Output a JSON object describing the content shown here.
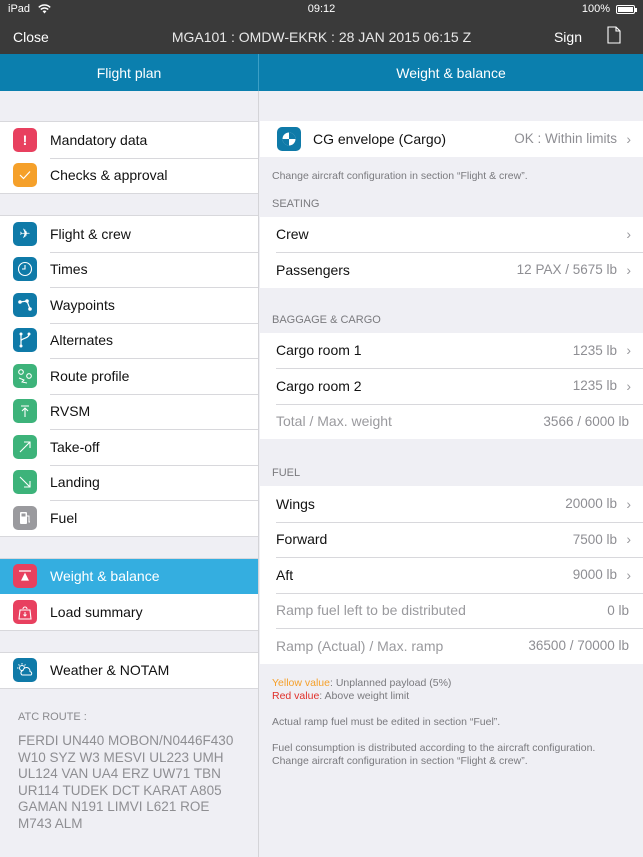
{
  "status_bar": {
    "device": "iPad",
    "time": "09:12",
    "battery": "100%",
    "battery_level": 1.0
  },
  "nav_bar": {
    "close_label": "Close",
    "title": "MGA101 : OMDW-EKRK : 28 JAN 2015 06:15 Z",
    "sign_label": "Sign",
    "doc_icon": "document-icon"
  },
  "tabs": {
    "left": "Flight plan",
    "right": "Weight & balance"
  },
  "sidebar": {
    "groups": [
      {
        "items": [
          {
            "label": "Mandatory data",
            "icon": "exclamation-icon",
            "color": "#e8405f"
          },
          {
            "label": "Checks & approval",
            "icon": "checkmark-icon",
            "color": "#f5a02a"
          }
        ]
      },
      {
        "items": [
          {
            "label": "Flight & crew",
            "icon": "airplane-icon",
            "color": "#0f7aa8"
          },
          {
            "label": "Times",
            "icon": "clock-icon",
            "color": "#0f7aa8"
          },
          {
            "label": "Waypoints",
            "icon": "waypoints-icon",
            "color": "#0f7aa8"
          },
          {
            "label": "Alternates",
            "icon": "fork-icon",
            "color": "#0f7aa8"
          },
          {
            "label": "Route profile",
            "icon": "route-pins-icon",
            "color": "#3db37a"
          },
          {
            "label": "RVSM",
            "icon": "arrow-up-bar-icon",
            "color": "#3db37a"
          },
          {
            "label": "Take-off",
            "icon": "arrow-up-right-icon",
            "color": "#3db37a"
          },
          {
            "label": "Landing",
            "icon": "arrow-down-right-icon",
            "color": "#3db37a"
          },
          {
            "label": "Fuel",
            "icon": "fuel-pump-icon",
            "color": "#9a9a9e"
          }
        ]
      },
      {
        "items": [
          {
            "label": "Weight & balance",
            "icon": "scale-icon",
            "color": "#e8405f",
            "active": true
          },
          {
            "label": "Load summary",
            "icon": "weight-bag-icon",
            "color": "#e8405f"
          }
        ]
      },
      {
        "items": [
          {
            "label": "Weather & NOTAM",
            "icon": "weather-icon",
            "color": "#0f7aa8"
          }
        ]
      }
    ],
    "atc_route": {
      "heading": "ATC ROUTE :",
      "text": "FERDI UN440 MOBON/N0446F430 W10 SYZ W3 MESVI UL223 UMH UL124 VAN UA4 ERZ UW71 TBN UR114 TUDEK DCT KARAT A805 GAMAN N191 LIMVI L621 ROE M743 ALM"
    }
  },
  "main": {
    "cg_envelope": {
      "label": "CG envelope (Cargo)",
      "value": "OK : Within limits",
      "icon": "cg-envelope-icon",
      "color": "#0f7aa8"
    },
    "cg_note": "Change aircraft configuration in section “Flight & crew”.",
    "seating": {
      "heading": "SEATING",
      "rows": [
        {
          "label": "Crew",
          "value": ""
        },
        {
          "label": "Passengers",
          "value": "12 PAX / 5675 lb"
        }
      ]
    },
    "baggage": {
      "heading": "BAGGAGE & CARGO",
      "rows": [
        {
          "label": "Cargo room 1",
          "value": "1235 lb"
        },
        {
          "label": "Cargo room 2",
          "value": "1235 lb"
        }
      ],
      "total": {
        "label": "Total / Max. weight",
        "value": "3566 / 6000 lb"
      }
    },
    "fuel": {
      "heading": "FUEL",
      "rows": [
        {
          "label": "Wings",
          "value": "20000 lb"
        },
        {
          "label": "Forward",
          "value": "7500 lb"
        },
        {
          "label": "Aft",
          "value": "9000 lb"
        }
      ],
      "left_to_distribute": {
        "label": "Ramp fuel left to be distributed",
        "value": "0 lb"
      },
      "ramp": {
        "label": "Ramp (Actual) / Max. ramp",
        "value": "36500 / 70000 lb"
      }
    },
    "legend": {
      "yellow_label": "Yellow value",
      "yellow_text": ": Unplanned payload (5%)",
      "yellow_color": "#f5a02a",
      "red_label": "Red value",
      "red_text": ": Above weight limit",
      "red_color": "#e0302a"
    },
    "notes": [
      "Actual ramp fuel must be edited in section “Fuel”.",
      "Fuel consumption is distributed according to the aircraft configuration. Change aircraft configuration in section “Flight & crew”."
    ]
  }
}
